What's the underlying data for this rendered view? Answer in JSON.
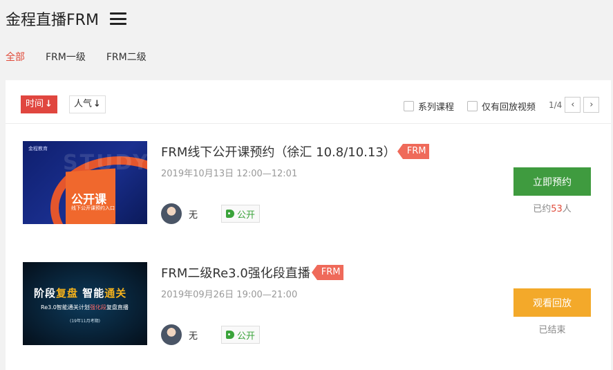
{
  "header": {
    "title": "金程直播FRM"
  },
  "categories": {
    "items": [
      "全部",
      "FRM一级",
      "FRM二级"
    ],
    "active": "全部"
  },
  "toolbar": {
    "sort_time": "时间",
    "sort_popularity": "人气",
    "sort_arrow": "↓",
    "filter_series": "系列课程",
    "filter_replay": "仅有回放视频",
    "page_indicator": "1/4",
    "prev_icon": "‹",
    "next_icon": "›"
  },
  "courses": [
    {
      "title": "FRM线下公开课预约（徐汇 10.8/10.13）",
      "tag": "FRM",
      "date": "2019年10月13日 12:00—12:01",
      "teacher": "无",
      "access": "公开",
      "button": "立即预约",
      "note_prefix": "已约",
      "note_count": "53",
      "note_suffix": "人",
      "thumb": {
        "logo": "金程教育",
        "watermark": "STUDY",
        "book_title": "公开课",
        "book_sub": "线下公开课预约入口"
      }
    },
    {
      "title": "FRM二级Re3.0强化段直播",
      "tag": "FRM",
      "date": "2019年09月26日 19:00—21:00",
      "teacher": "无",
      "access": "公开",
      "button": "观看回放",
      "note": "已结束",
      "thumb": {
        "title_a": "阶段",
        "title_b": "复盘",
        "title_c": "智能",
        "title_d": "通关",
        "sub_a": "Re3.0智能通关计划",
        "sub_b": "强化段",
        "sub_c": "复盘直播",
        "note": "(19年11月考期)"
      }
    }
  ],
  "colors": {
    "accent_red": "#e0463f",
    "tag_red": "#ef6a5a",
    "button_green": "#3f9b3f",
    "button_orange": "#f3a92a",
    "public_green": "#3aa33a"
  }
}
